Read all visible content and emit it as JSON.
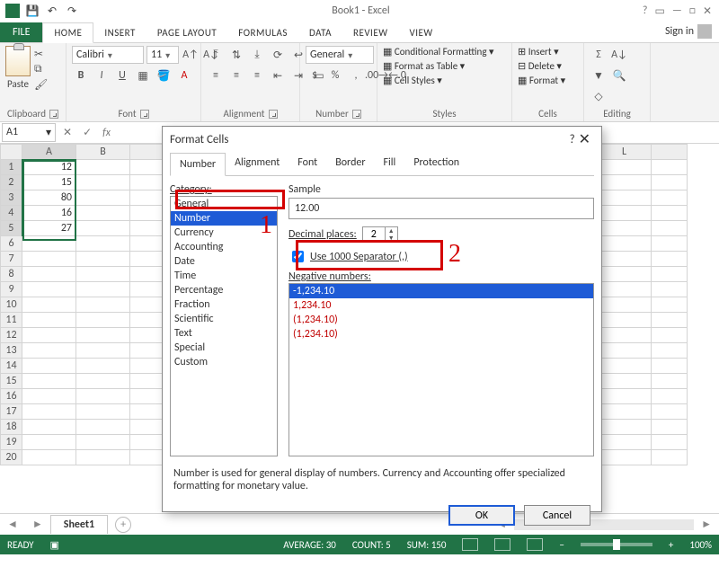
{
  "window": {
    "title": "Book1 - Excel"
  },
  "qat": {
    "save": "💾",
    "undo": "↶",
    "redo": "↷"
  },
  "tabs": {
    "file": "FILE",
    "home": "HOME",
    "insert": "INSERT",
    "page": "PAGE LAYOUT",
    "formulas": "FORMULAS",
    "data": "DATA",
    "review": "REVIEW",
    "view": "VIEW",
    "signin": "Sign in"
  },
  "ribbon": {
    "clipboard": {
      "label": "Clipboard",
      "paste": "Paste"
    },
    "font": {
      "label": "Font",
      "name": "Calibri",
      "size": "11"
    },
    "alignment": {
      "label": "Alignment"
    },
    "number": {
      "label": "Number",
      "format": "General"
    },
    "styles": {
      "label": "Styles",
      "cond": "Conditional Formatting",
      "table": "Format as Table",
      "cell": "Cell Styles"
    },
    "cells": {
      "label": "Cells",
      "insert": "Insert",
      "delete": "Delete",
      "format": "Format"
    },
    "editing": {
      "label": "Editing"
    }
  },
  "namebox": "A1",
  "columns": [
    "A",
    "B"
  ],
  "columns_right": [
    "L"
  ],
  "rows": [
    {
      "n": 1,
      "a": "12"
    },
    {
      "n": 2,
      "a": "15"
    },
    {
      "n": 3,
      "a": "80"
    },
    {
      "n": 4,
      "a": "16"
    },
    {
      "n": 5,
      "a": "27"
    },
    {
      "n": 6,
      "a": ""
    },
    {
      "n": 7,
      "a": ""
    },
    {
      "n": 8,
      "a": ""
    },
    {
      "n": 9,
      "a": ""
    },
    {
      "n": 10,
      "a": ""
    },
    {
      "n": 11,
      "a": ""
    },
    {
      "n": 12,
      "a": ""
    },
    {
      "n": 13,
      "a": ""
    },
    {
      "n": 14,
      "a": ""
    },
    {
      "n": 15,
      "a": ""
    },
    {
      "n": 16,
      "a": ""
    },
    {
      "n": 17,
      "a": ""
    },
    {
      "n": 18,
      "a": ""
    },
    {
      "n": 19,
      "a": ""
    },
    {
      "n": 20,
      "a": ""
    }
  ],
  "sheet": {
    "tab": "Sheet1"
  },
  "status": {
    "ready": "READY",
    "avg": "AVERAGE: 30",
    "count": "COUNT: 5",
    "sum": "SUM: 150",
    "zoom": "100%"
  },
  "dialog": {
    "title": "Format Cells",
    "help": "?",
    "tabs": {
      "number": "Number",
      "alignment": "Alignment",
      "font": "Font",
      "border": "Border",
      "fill": "Fill",
      "protection": "Protection"
    },
    "category_label": "Category:",
    "categories": [
      "General",
      "Number",
      "Currency",
      "Accounting",
      "Date",
      "Time",
      "Percentage",
      "Fraction",
      "Scientific",
      "Text",
      "Special",
      "Custom"
    ],
    "selected_category": 1,
    "sample_label": "Sample",
    "sample_value": "12.00",
    "decimal_label": "Decimal places:",
    "decimal_value": "2",
    "thousands_label": "Use 1000 Separator (,)",
    "thousands_checked": true,
    "neg_label": "Negative numbers:",
    "neg": [
      "-1,234.10",
      "1,234.10",
      "(1,234.10)",
      "(1,234.10)"
    ],
    "note": "Number is used for general display of numbers.  Currency and Accounting offer specialized formatting for monetary value.",
    "ok": "OK",
    "cancel": "Cancel"
  },
  "annotations": {
    "one": "1",
    "two": "2"
  }
}
